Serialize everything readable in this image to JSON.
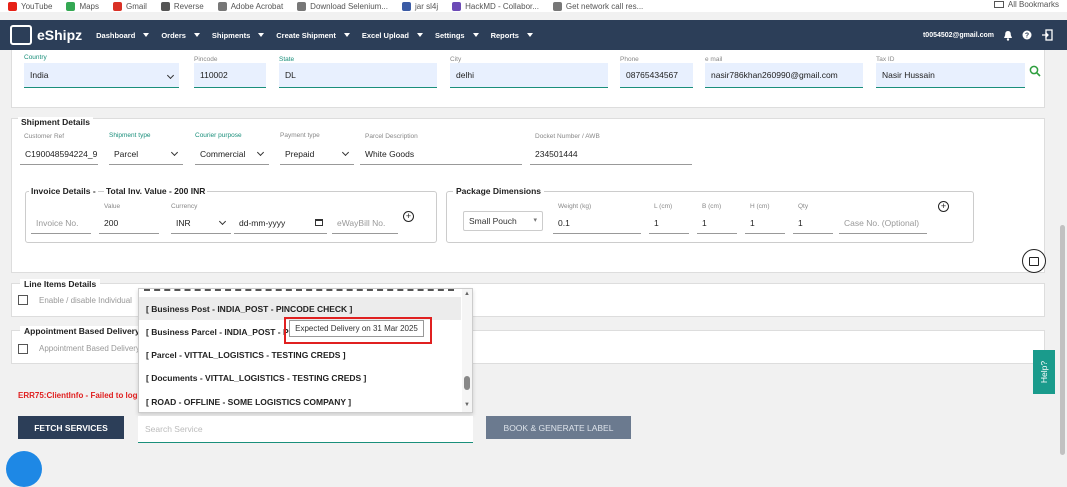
{
  "bookmarks": {
    "items": [
      {
        "label": "YouTube",
        "color": "#e62117"
      },
      {
        "label": "Maps",
        "color": "#34a853"
      },
      {
        "label": "Gmail",
        "color": "#d93025"
      },
      {
        "label": "Reverse",
        "color": "#555555"
      },
      {
        "label": "Adobe Acrobat",
        "color": "#777777"
      },
      {
        "label": "Download Selenium...",
        "color": "#777777"
      },
      {
        "label": "jar sl4j",
        "color": "#3b5ba5"
      },
      {
        "label": "HackMD - Collabor...",
        "color": "#6c4ab6"
      },
      {
        "label": "Get network call res...",
        "color": "#777777"
      }
    ],
    "all_bookmarks": "All Bookmarks"
  },
  "navbar": {
    "brand": "eShipz",
    "items": [
      "Dashboard",
      "Orders",
      "Shipments",
      "Create Shipment",
      "Excel Upload",
      "Settings",
      "Reports"
    ],
    "user_email": "t0054502@gmail.com"
  },
  "address": {
    "country_label": "Country",
    "country": "India",
    "pincode_label": "Pincode",
    "pincode": "110002",
    "state_label": "State",
    "state": "DL",
    "city_label": "City",
    "city": "delhi",
    "phone_label": "Phone",
    "phone": "08765434567",
    "email_label": "e mail",
    "email": "nasir786khan260990@gmail.com",
    "taxid_label": "Tax ID",
    "taxid": "Nasir Hussain"
  },
  "shipment": {
    "title": "Shipment Details",
    "customer_ref_label": "Customer Ref",
    "customer_ref": "C190048594224_9",
    "shipment_type_label": "Shipment type",
    "shipment_type": "Parcel",
    "courier_purpose_label": "Courier purpose",
    "courier_purpose": "Commercial",
    "payment_type_label": "Payment type",
    "payment_type": "Prepaid",
    "parcel_desc_label": "Parcel Description",
    "parcel_desc": "White Goods",
    "docket_label": "Docket Number / AWB",
    "docket": "234501444"
  },
  "invoice": {
    "title": "Invoice Details -",
    "total": "Total Inv. Value - 200 INR",
    "invoice_no_placeholder": "Invoice No.",
    "value_label": "Value",
    "value": "200",
    "currency_label": "Currency",
    "currency": "INR",
    "date_placeholder": "dd-mm-yyyy",
    "ewaybill_placeholder": "eWayBill No."
  },
  "package": {
    "title": "Package Dimensions",
    "type": "Small Pouch",
    "weight_label": "Weight (kg)",
    "weight": "0.1",
    "l_label": "L (cm)",
    "l": "1",
    "b_label": "B (cm)",
    "b": "1",
    "h_label": "H (cm)",
    "h": "1",
    "qty_label": "Qty",
    "qty": "1",
    "case_placeholder": "Case No. (Optional)"
  },
  "line_items": {
    "title": "Line Items Details",
    "toggle_label": "Enable / disable Individual"
  },
  "appointment": {
    "title": "Appointment Based Delivery",
    "toggle_label": "Appointment Based Delivery"
  },
  "dropdown": {
    "options": [
      "[ Business Post - INDIA_POST - PINCODE CHECK ]",
      "[ Business Parcel - INDIA_POST - PINCODE CHECK ]",
      "[ Parcel - VITTAL_LOGISTICS - TESTING CREDS ]",
      "[ Documents - VITTAL_LOGISTICS - TESTING CREDS ]",
      "[ ROAD - OFFLINE - SOME LOGISTICS COMPANY ]"
    ],
    "search_placeholder": "Search Service"
  },
  "tooltip": "Expected Delivery on 31 Mar 2025",
  "error": "ERR75:ClientInfo - Failed to log",
  "buttons": {
    "fetch": "FETCH SERVICES",
    "book": "BOOK & GENERATE LABEL",
    "help": "Help?"
  },
  "colors": {
    "nav": "#2c3e58",
    "accent": "#1a8f7b",
    "error": "#e02020",
    "help": "#1a9b8c"
  }
}
